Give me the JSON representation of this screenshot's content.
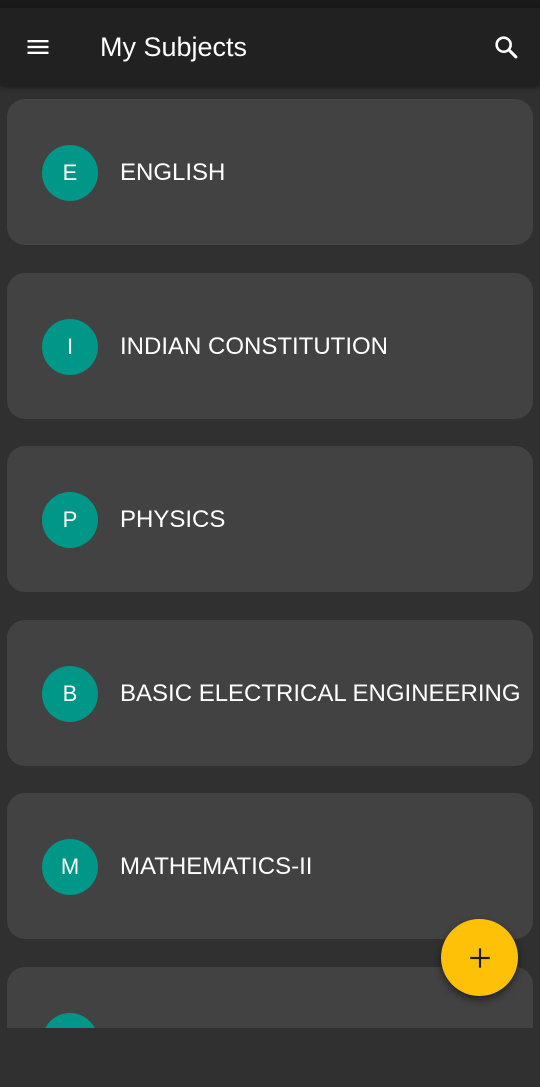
{
  "app_bar": {
    "title": "My Subjects",
    "menu_icon": "hamburger-menu-icon",
    "search_icon": "search-icon"
  },
  "subjects": [
    {
      "initial": "E",
      "name": "ENGLISH"
    },
    {
      "initial": "I",
      "name": "INDIAN CONSTITUTION"
    },
    {
      "initial": "P",
      "name": "PHYSICS"
    },
    {
      "initial": "B",
      "name": "BASIC ELECTRICAL ENGINEERING"
    },
    {
      "initial": "M",
      "name": "MATHEMATICS-II"
    },
    {
      "initial": "",
      "name": ""
    }
  ],
  "fab": {
    "icon": "plus-icon"
  },
  "colors": {
    "background": "#303030",
    "app_bar": "#212121",
    "card": "#424242",
    "avatar": "#009688",
    "fab": "#ffc107",
    "text": "#ffffff"
  }
}
